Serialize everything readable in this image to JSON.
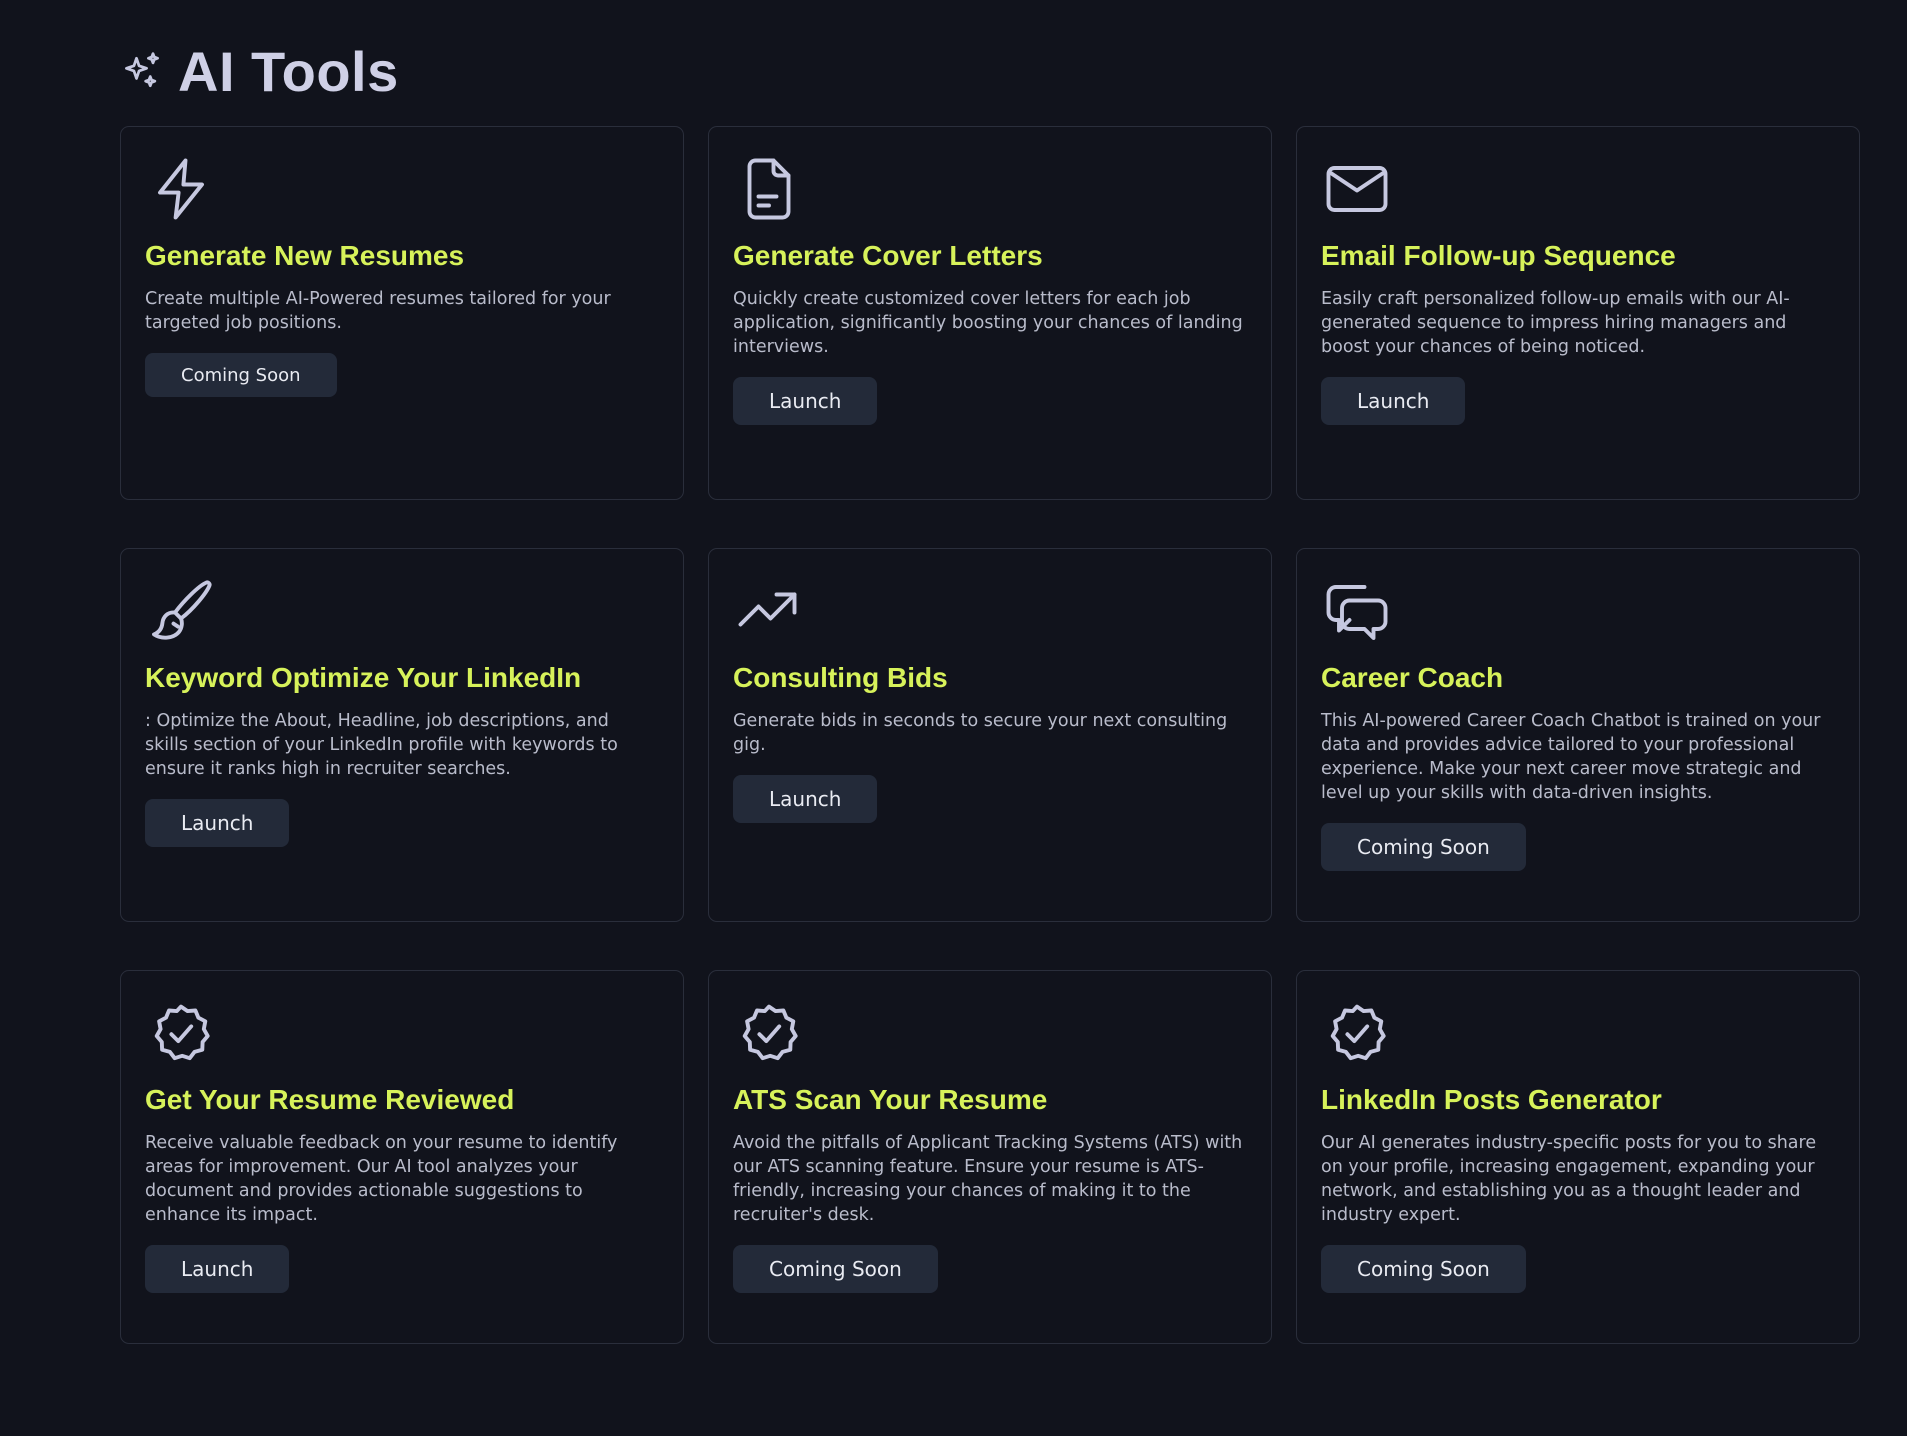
{
  "page": {
    "title": "AI Tools",
    "icon": "sparkles-icon"
  },
  "colors": {
    "background": "#11131c",
    "card_border": "#2a2e3b",
    "title_accent": "#d7f25a",
    "button_bg": "#232a39",
    "icon_stroke": "#c6c8e0"
  },
  "cards": [
    {
      "icon": "lightning-icon",
      "title": "Generate New Resumes",
      "description": "Create multiple AI-Powered resumes tailored for your targeted job positions.",
      "button": "Coming Soon"
    },
    {
      "icon": "document-icon",
      "title": "Generate Cover Letters",
      "description": "Quickly create customized cover letters for each job application, significantly boosting your chances of landing interviews.",
      "button": "Launch"
    },
    {
      "icon": "envelope-icon",
      "title": "Email Follow-up Sequence",
      "description": "Easily craft personalized follow-up emails with our AI-generated sequence to impress hiring managers and boost your chances of being noticed.",
      "button": "Launch"
    },
    {
      "icon": "paintbrush-icon",
      "title": "Keyword Optimize Your LinkedIn",
      "description": ": Optimize the About, Headline, job descriptions, and skills section of your LinkedIn profile with keywords to ensure it ranks high in recruiter searches.",
      "button": "Launch"
    },
    {
      "icon": "trending-up-icon",
      "title": "Consulting Bids",
      "description": "Generate bids in seconds to secure your next consulting gig.",
      "button": "Launch"
    },
    {
      "icon": "chat-bubbles-icon",
      "title": "Career Coach",
      "description": "This AI-powered Career Coach Chatbot is trained on your data and provides advice tailored to your professional experience. Make your next career move strategic and level up your skills with data-driven insights.",
      "button": "Coming Soon"
    },
    {
      "icon": "badge-check-icon",
      "title": "Get Your Resume Reviewed",
      "description": "Receive valuable feedback on your resume to identify areas for improvement. Our AI tool analyzes your document and provides actionable suggestions to enhance its impact.",
      "button": "Launch"
    },
    {
      "icon": "badge-check-icon",
      "title": "ATS Scan Your Resume",
      "description": "Avoid the pitfalls of Applicant Tracking Systems (ATS) with our ATS scanning feature. Ensure your resume is ATS-friendly, increasing your chances of making it to the recruiter's desk.",
      "button": "Coming Soon"
    },
    {
      "icon": "badge-check-icon",
      "title": "LinkedIn Posts Generator",
      "description": "Our AI generates industry-specific posts for you to share on your profile, increasing engagement, expanding your network, and establishing you as a thought leader and industry expert.",
      "button": "Coming Soon"
    }
  ]
}
